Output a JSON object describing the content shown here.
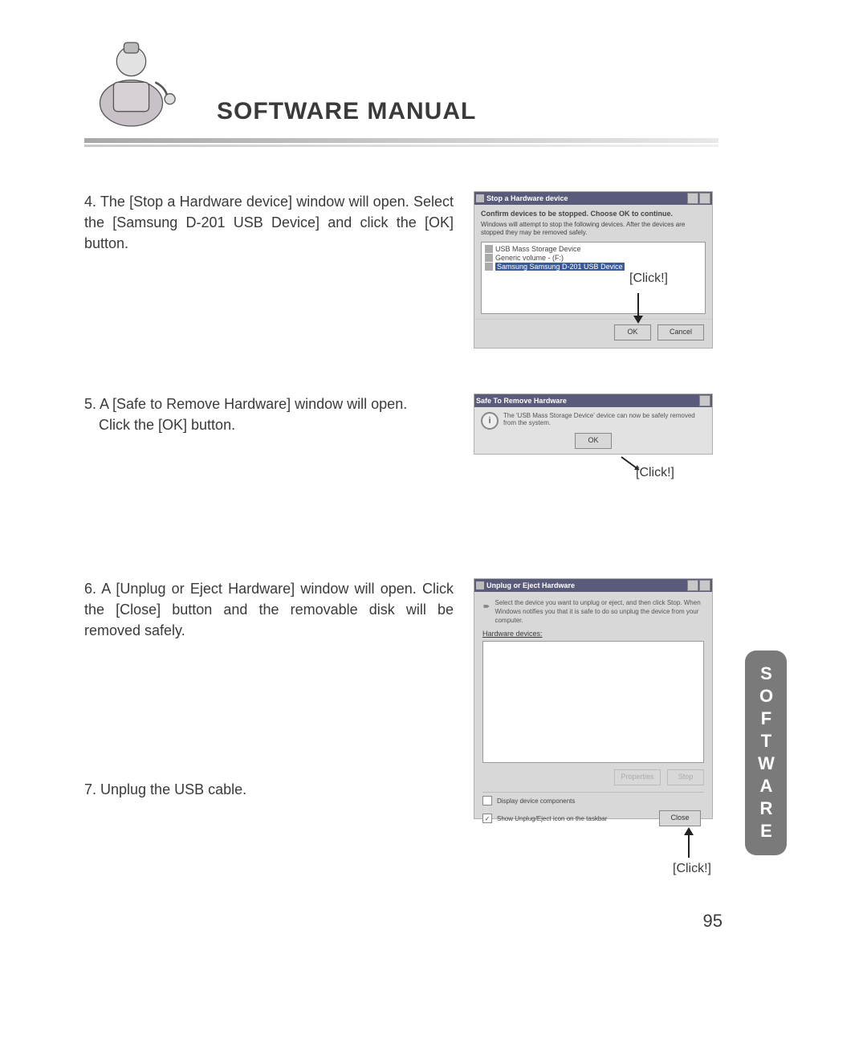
{
  "header": {
    "title": "SOFTWARE MANUAL"
  },
  "steps": {
    "s4": "4. The [Stop a Hardware device] window will open. Select the [Samsung D-201 USB Device] and click the [OK] button.",
    "s5_l1": "5. A [Safe to Remove Hardware] window will open.",
    "s5_l2": "Click the [OK] button.",
    "s6": "6. A [Unplug or Eject Hardware] window will open. Click the [Close] button and the removable disk will be removed safely.",
    "s7": "7. Unplug the USB cable."
  },
  "dialog1": {
    "title": "Stop a Hardware device",
    "line1": "Confirm devices to be stopped. Choose OK to continue.",
    "line2": "Windows will attempt to stop the following devices. After the devices are stopped they may be removed safely.",
    "dev1": "USB Mass Storage Device",
    "dev2": "Generic volume - (F:)",
    "dev3": "Samsung Samsung D-201 USB Device",
    "ok": "OK",
    "cancel": "Cancel"
  },
  "dialog2": {
    "title": "Safe To Remove Hardware",
    "msg": "The 'USB Mass Storage Device' device can now be safely removed from the system.",
    "ok": "OK"
  },
  "dialog3": {
    "title": "Unplug or Eject Hardware",
    "desc": "Select the device you want to unplug or eject, and then click Stop. When Windows notifies you that it is safe to do so unplug the device from your computer.",
    "hw_label": "Hardware devices:",
    "properties": "Properties",
    "stop": "Stop",
    "chk1": "Display device components",
    "chk2": "Show Unplug/Eject icon on the taskbar",
    "close": "Close"
  },
  "annotations": {
    "click": "[Click!]"
  },
  "sidebar": {
    "label": "SOFTWARE"
  },
  "page_number": "95"
}
